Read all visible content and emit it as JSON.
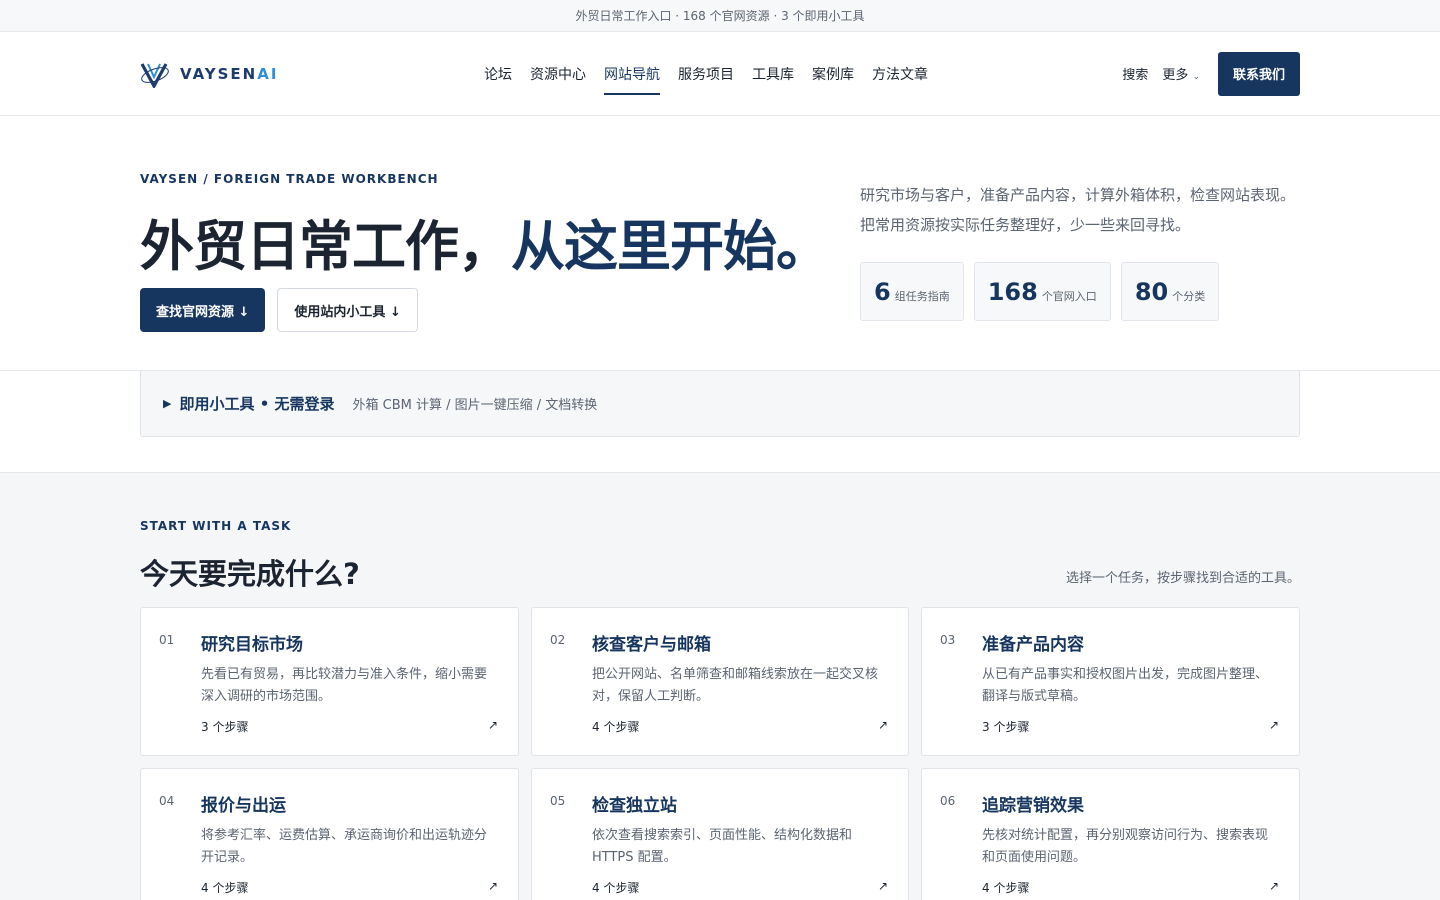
{
  "topbar": {
    "text": "外贸日常工作入口 · 168 个官网资源 · 3 个即用小工具"
  },
  "header": {
    "logo": {
      "text_main": "VAYSEN",
      "text_accent": "AI"
    },
    "nav": [
      {
        "label": "论坛"
      },
      {
        "label": "资源中心"
      },
      {
        "label": "网站导航",
        "active": true
      },
      {
        "label": "服务项目"
      },
      {
        "label": "工具库"
      },
      {
        "label": "案例库"
      },
      {
        "label": "方法文章"
      }
    ],
    "search_label": "搜索",
    "more_label": "更多",
    "more_chevron": "⌄",
    "contact_label": "联系我们"
  },
  "hero": {
    "eyebrow": "VAYSEN / FOREIGN TRADE WORKBENCH",
    "title_main": "外贸日常工作，",
    "title_accent": "从这里开始。",
    "primary_button": "查找官网资源 ↓",
    "secondary_button": "使用站内小工具 ↓",
    "description": "研究市场与客户，准备产品内容，计算外箱体积，检查网站表现。把常用资源按实际任务整理好，少一些来回寻找。",
    "stats": [
      {
        "value": "6",
        "label": "组任务指南"
      },
      {
        "value": "168",
        "label": "个官网入口"
      },
      {
        "value": "80",
        "label": "个分类"
      }
    ]
  },
  "tools": {
    "toggle_icon": "▶",
    "title": "即用小工具 • 无需登录",
    "subtitle": "外箱 CBM 计算 / 图片一键压缩 / 文档转换"
  },
  "tasks": {
    "eyebrow": "START WITH A TASK",
    "title": "今天要完成什么?",
    "note": "选择一个任务，按步骤找到合适的工具。",
    "cards": [
      {
        "num": "01",
        "title": "研究目标市场",
        "desc": "先看已有贸易，再比较潜力与准入条件，缩小需要深入调研的市场范围。",
        "steps": "3 个步骤",
        "arrow": "↗"
      },
      {
        "num": "02",
        "title": "核查客户与邮箱",
        "desc": "把公开网站、名单筛查和邮箱线索放在一起交叉核对，保留人工判断。",
        "steps": "4 个步骤",
        "arrow": "↗"
      },
      {
        "num": "03",
        "title": "准备产品内容",
        "desc": "从已有产品事实和授权图片出发，完成图片整理、翻译与版式草稿。",
        "steps": "3 个步骤",
        "arrow": "↗"
      },
      {
        "num": "04",
        "title": "报价与出运",
        "desc": "将参考汇率、运费估算、承运商询价和出运轨迹分开记录。",
        "steps": "4 个步骤",
        "arrow": "↗"
      },
      {
        "num": "05",
        "title": "检查独立站",
        "desc": "依次查看搜索索引、页面性能、结构化数据和 HTTPS 配置。",
        "steps": "4 个步骤",
        "arrow": "↗"
      },
      {
        "num": "06",
        "title": "追踪营销效果",
        "desc": "先核对统计配置，再分别观察访问行为、搜索表现和页面使用问题。",
        "steps": "4 个步骤",
        "arrow": "↗"
      }
    ]
  },
  "colors": {
    "primary": "#17365f",
    "muted": "#5b6472",
    "background_alt": "#f5f6f8"
  }
}
